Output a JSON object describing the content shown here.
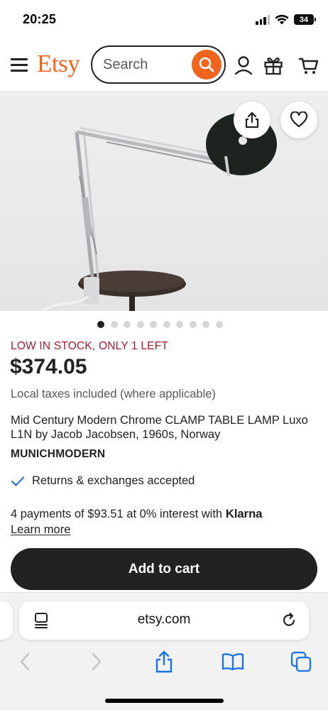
{
  "status_bar": {
    "time": "20:25",
    "battery": "34"
  },
  "header": {
    "logo": "Etsy",
    "search": {
      "placeholder": "Search",
      "value": ""
    },
    "icons": [
      "menu-icon",
      "search-icon",
      "account-icon",
      "gift-icon",
      "cart-icon"
    ]
  },
  "product": {
    "image_index": 1,
    "image_count": 10,
    "stock_notice": "LOW IN STOCK, ONLY 1 LEFT",
    "price": "$374.05",
    "tax_note": "Local taxes included (where applicable)",
    "title": "Mid Century Modern Chrome CLAMP TABLE LAMP Luxo L1N by Jacob Jacobsen, 1960s, Norway",
    "shop_name": "MUNICHMODERN",
    "returns": "Returns & exchanges accepted",
    "payments_text": "4 payments of $93.51 at 0% interest with",
    "payments_provider": "Klarna",
    "learn_more": "Learn more",
    "add_to_cart": "Add to cart"
  },
  "browser": {
    "url": "etsy.com"
  },
  "colors": {
    "brand": "#F1641E",
    "stock": "#A61A2E",
    "check": "#2F6FD6",
    "safari_blue": "#1a73e8",
    "dark": "#222222"
  }
}
